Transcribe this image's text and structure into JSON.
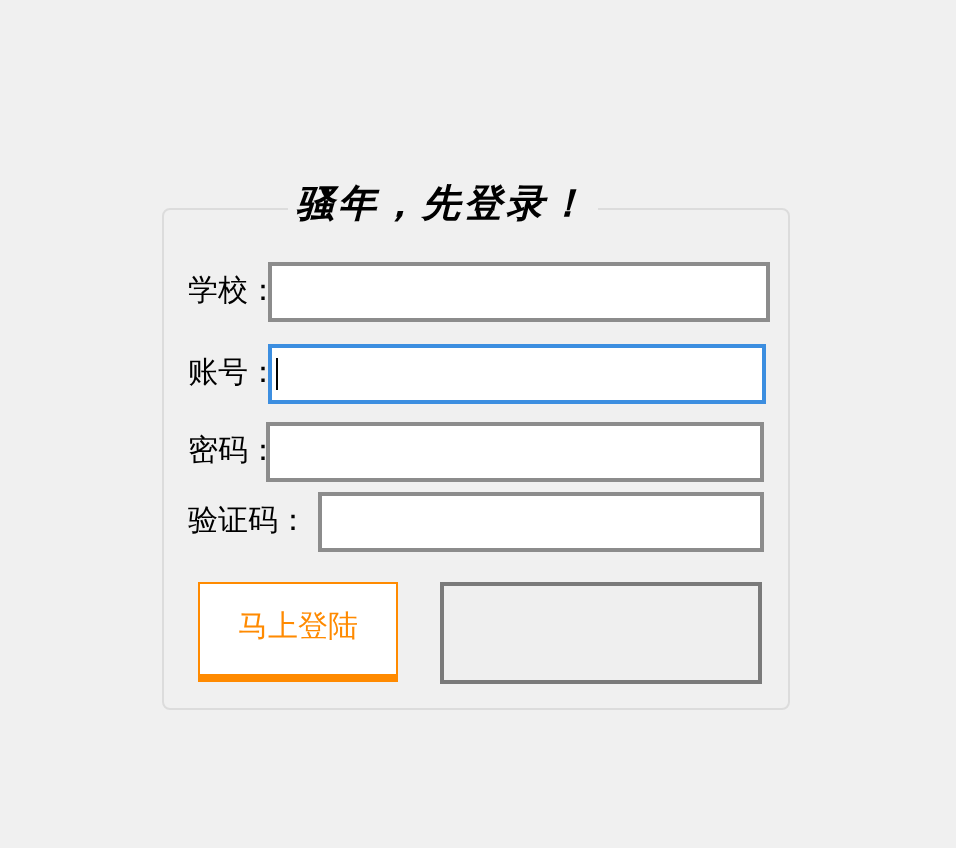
{
  "group_title": "骚年，先登录！",
  "fields": [
    {
      "label": "学校：",
      "focused": false
    },
    {
      "label": "账号：",
      "focused": true
    },
    {
      "label": "密码：",
      "focused": false
    },
    {
      "label": "验证码：",
      "focused": false
    }
  ],
  "login_button": "马上登陆"
}
